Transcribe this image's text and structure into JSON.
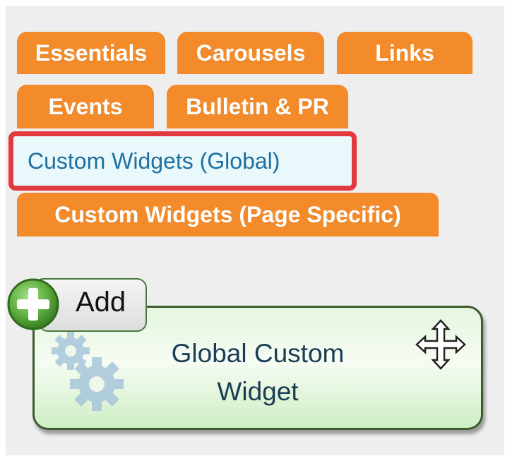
{
  "tabs": {
    "essentials": "Essentials",
    "carousels": "Carousels",
    "links": "Links",
    "events": "Events",
    "bulletin": "Bulletin & PR",
    "global": "Custom Widgets (Global)",
    "page_specific": "Custom Widgets (Page Specific)",
    "active": "Custom Widgets (Global)"
  },
  "widget": {
    "title_line1": "Global Custom",
    "title_line2": "Widget",
    "icon": "gears-icon",
    "move_icon": "move-icon"
  },
  "add_button": {
    "label": "Add",
    "icon": "plus-circle-icon"
  },
  "colors": {
    "tab_orange": "#f38b2b",
    "highlight_red": "#e23a3f",
    "active_tab_bg": "#e9f8fb",
    "active_tab_text": "#1f6f9f",
    "widget_green": "#cfeec4"
  }
}
